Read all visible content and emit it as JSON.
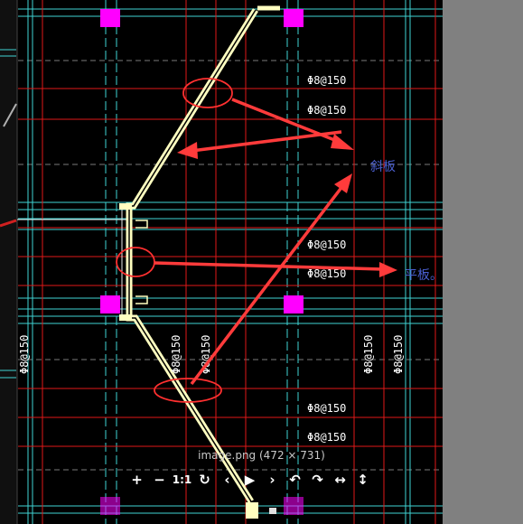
{
  "viewer": {
    "caption": "image.png (472 × 731)",
    "toolbar": [
      {
        "icon": "zoom-in-icon",
        "glyph": "+"
      },
      {
        "icon": "zoom-out-icon",
        "glyph": "−"
      },
      {
        "icon": "actual-size-icon",
        "glyph": "1:1"
      },
      {
        "icon": "reset-icon",
        "glyph": "↻"
      },
      {
        "icon": "previous-icon",
        "glyph": "‹"
      },
      {
        "icon": "play-icon",
        "glyph": "▶"
      },
      {
        "icon": "next-icon",
        "glyph": "›"
      },
      {
        "icon": "rotate-left-icon",
        "glyph": "↶"
      },
      {
        "icon": "rotate-right-icon",
        "glyph": "↷"
      },
      {
        "icon": "flip-horizontal-icon",
        "glyph": "↔"
      },
      {
        "icon": "flip-vertical-icon",
        "glyph": "↕"
      }
    ]
  },
  "drawing": {
    "rebar_label": "Φ8@150",
    "annotations": {
      "sloped_slab": "斜板",
      "flat_slab": "平板。"
    },
    "colors": {
      "background": "#000000",
      "annotation_text": "#4a5fd0",
      "arrow": "#ff3b3b",
      "stair_line": "#ffffc0",
      "column": "#ff00ff",
      "grid_red": "#e01818",
      "grid_cyan": "#3fd3d3"
    }
  }
}
